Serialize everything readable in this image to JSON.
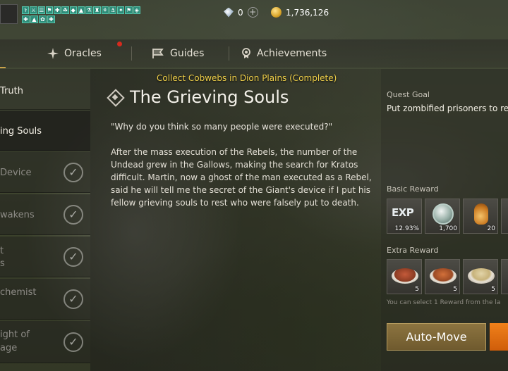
{
  "currency": {
    "gems": "0",
    "gold": "1,736,126"
  },
  "buffs": [
    "⚕",
    "⚔",
    "☰",
    "⚑",
    "✚",
    "☘",
    "◆",
    "▲",
    "⚗",
    "♜",
    "⚘",
    "⚓",
    "✦",
    "⚑",
    "◈",
    "✚",
    "▲",
    "✿",
    "✚"
  ],
  "tabs": [
    {
      "label": "Oracles",
      "icon": "star-burst-icon"
    },
    {
      "label": "Guides",
      "icon": "flag-icon"
    },
    {
      "label": "Achievements",
      "icon": "medal-icon"
    }
  ],
  "quest_list": [
    {
      "label": "Truth"
    },
    {
      "label": "ing Souls"
    },
    {
      "label": "Device"
    },
    {
      "label": "wakens"
    },
    {
      "label": "t\ns"
    },
    {
      "label": "chemist"
    },
    {
      "label": "ight of\nage"
    }
  ],
  "notice": "Collect Cobwebs in Dion Plains (Complete)",
  "quest": {
    "title": "The Grieving Souls",
    "quote": "\"Why do you think so many people were executed?\"",
    "description": "After the mass execution of the Rebels, the number of the Undead grew in the Gallows, making the search for Kratos difficult. Martin, now a ghost of the man executed as a Rebel, said he will tell me the secret of the Giant's device if I put his fellow grieving souls to rest who were falsely put to death."
  },
  "right": {
    "goal_label": "Quest Goal",
    "goal_text": "Put zombified prisoners to re",
    "basic_label": "Basic Reward",
    "basic_rewards": [
      {
        "icon": "exp-icon",
        "text": "EXP",
        "qty": "12.93%"
      },
      {
        "icon": "silver-coin-icon",
        "qty": "1,700"
      },
      {
        "icon": "potion-icon",
        "qty": "20"
      }
    ],
    "extra_label": "Extra Reward",
    "extra_rewards": [
      {
        "icon": "steak-dish-icon",
        "qty": "5"
      },
      {
        "icon": "skewer-dish-icon",
        "qty": "5"
      },
      {
        "icon": "bowl-dish-icon",
        "qty": "5"
      }
    ],
    "select_note": "You can select 1 Reward from the la",
    "automove_label": "Auto-Move"
  }
}
